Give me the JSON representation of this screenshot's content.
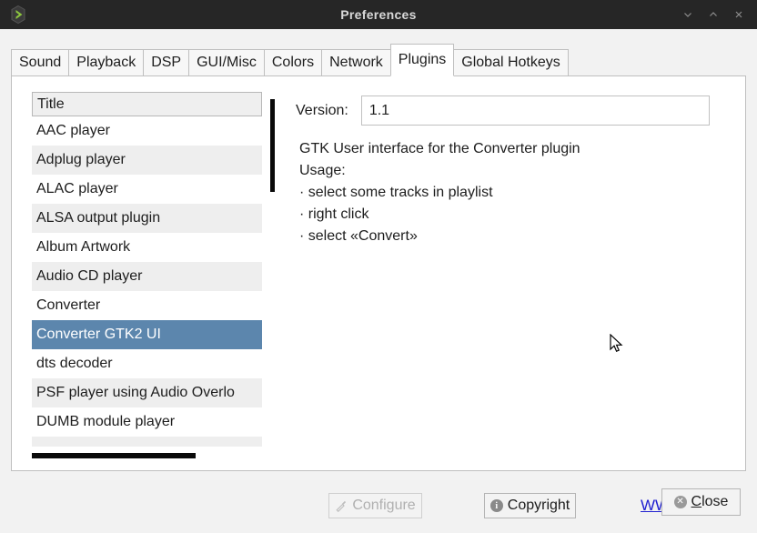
{
  "window": {
    "title": "Preferences",
    "app_icon": "deadbeef-play-icon",
    "controls": [
      {
        "name": "minimize",
        "glyph": "∨"
      },
      {
        "name": "maximize",
        "glyph": "∧"
      },
      {
        "name": "close",
        "glyph": "✕"
      }
    ],
    "titlebar_bg": "#262626",
    "title_color": "#d8d8d8"
  },
  "tabs": [
    {
      "label": "Sound",
      "active": false
    },
    {
      "label": "Playback",
      "active": false
    },
    {
      "label": "DSP",
      "active": false
    },
    {
      "label": "GUI/Misc",
      "active": false
    },
    {
      "label": "Colors",
      "active": false
    },
    {
      "label": "Network",
      "active": false
    },
    {
      "label": "Plugins",
      "active": true
    },
    {
      "label": "Global Hotkeys",
      "active": false
    }
  ],
  "plugin_list": {
    "column_header": "Title",
    "selection_color": "#5c86ad",
    "rows": [
      {
        "label": "AAC player",
        "selected": false
      },
      {
        "label": "Adplug player",
        "selected": false
      },
      {
        "label": "ALAC player",
        "selected": false
      },
      {
        "label": "ALSA output plugin",
        "selected": false
      },
      {
        "label": "Album Artwork",
        "selected": false
      },
      {
        "label": "Audio CD player",
        "selected": false
      },
      {
        "label": "Converter",
        "selected": false
      },
      {
        "label": "Converter GTK2 UI",
        "selected": true
      },
      {
        "label": "dts decoder",
        "selected": false
      },
      {
        "label": "PSF player using Audio Overlo",
        "selected": false
      },
      {
        "label": "DUMB module player",
        "selected": false
      },
      {
        "label": "",
        "selected": false
      }
    ]
  },
  "details": {
    "version_label": "Version:",
    "version_value": "1.1",
    "version_placeholder": "",
    "description_lines": [
      "GTK User interface for the Converter plugin",
      "Usage:",
      "· select some tracks in playlist",
      "· right click",
      "· select «Convert»"
    ]
  },
  "actions": {
    "configure_label": "Configure",
    "configure_enabled": false,
    "copyright_label": "Copyright",
    "www_label": "WWW",
    "www_color": "#2020d0"
  },
  "footer": {
    "close_mnemonic": "C",
    "close_rest": "lose"
  }
}
